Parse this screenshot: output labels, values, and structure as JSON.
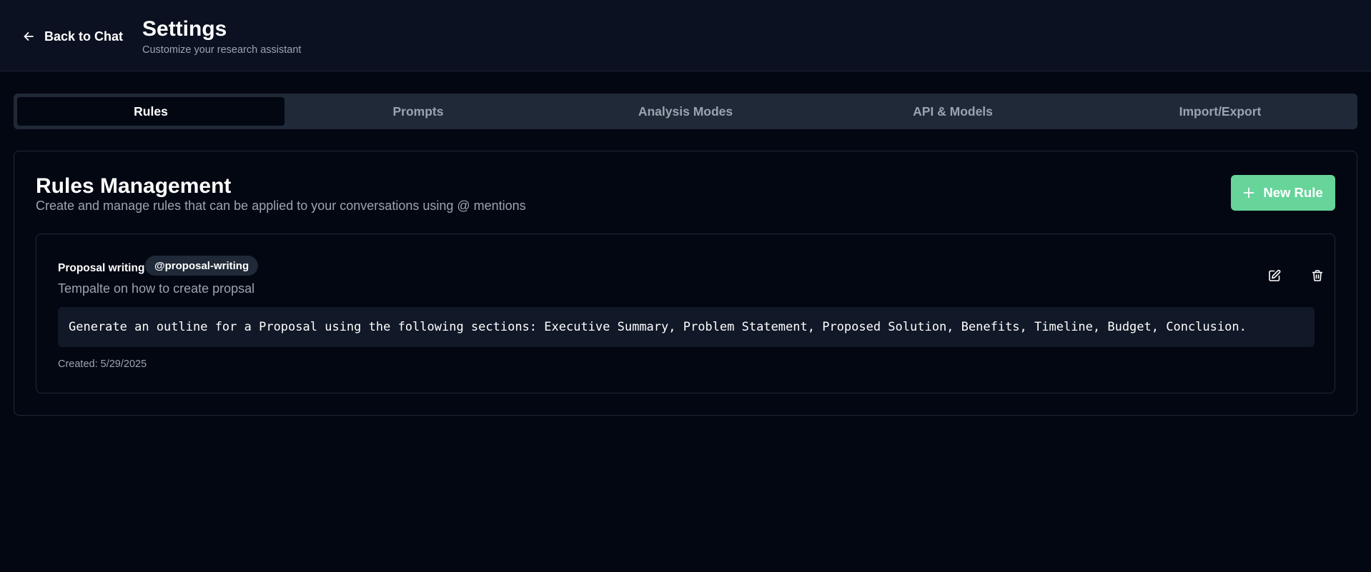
{
  "header": {
    "back_label": "Back to Chat",
    "title": "Settings",
    "subtitle": "Customize your research assistant"
  },
  "tabs": [
    {
      "label": "Rules",
      "active": true
    },
    {
      "label": "Prompts",
      "active": false
    },
    {
      "label": "Analysis Modes",
      "active": false
    },
    {
      "label": "API & Models",
      "active": false
    },
    {
      "label": "Import/Export",
      "active": false
    }
  ],
  "rules_panel": {
    "title": "Rules Management",
    "description": "Create and manage rules that can be applied to your conversations using @ mentions",
    "new_rule_label": "New Rule",
    "rules": [
      {
        "name": "Proposal writing",
        "tag": "@proposal-writing",
        "description": "Tempalte on how to create propsal",
        "content": "Generate an outline for a Proposal using the following sections: Executive Summary, Problem Statement, Proposed Solution, Benefits, Timeline, Budget, Conclusion.",
        "created": "Created: 5/29/2025"
      }
    ]
  },
  "icons": {
    "back": "arrow-left-icon",
    "new_rule": "plus-icon",
    "edit": "edit-icon",
    "delete": "trash-icon"
  },
  "colors": {
    "background": "#030712",
    "header_bg": "#0b1120",
    "tab_bar_bg": "#1f2937",
    "accent": "#67d49a",
    "muted_text": "#9ca3af",
    "code_bg": "#111827"
  }
}
